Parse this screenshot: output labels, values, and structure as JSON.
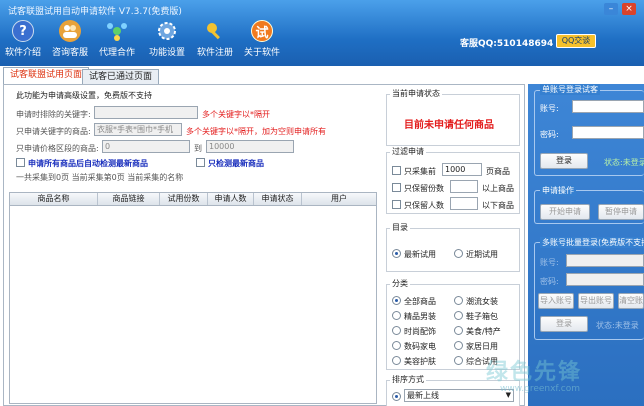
{
  "window": {
    "title": "试客联盟试用自动申请软件 V7.3.7(免费版)",
    "colors": {
      "titlebar": "#2a78cf",
      "accent_red": "#e31d1d",
      "link_blue": "#1a2fbd"
    }
  },
  "toolbar": {
    "items": [
      {
        "label": "软件介绍",
        "icon": "help-icon"
      },
      {
        "label": "咨询客服",
        "icon": "people-icon"
      },
      {
        "label": "代理合作",
        "icon": "network-icon"
      },
      {
        "label": "功能设置",
        "icon": "gear-icon"
      },
      {
        "label": "软件注册",
        "icon": "key-icon"
      },
      {
        "label": "关于软件",
        "icon": "try-icon",
        "glyph": "试"
      }
    ],
    "qq_label": "客服QQ:510148694",
    "qq_button": "QQ交谈"
  },
  "tabs": [
    {
      "label": "试客联盟试用页面",
      "active": true
    },
    {
      "label": "试客已通过页面",
      "active": false
    }
  ],
  "settings": {
    "heading": "此功能为申请高级设置，免费版不支持",
    "exclude_keyword_label": "申请时排除的关键字:",
    "exclude_keyword_value": "",
    "exclude_keyword_hint": "多个关键字以*隔开",
    "include_keyword_label": "只申请关键字的商品:",
    "include_keyword_value": "衣服*手表*围巾*手机",
    "include_keyword_hint": "多个关键字以*隔开，加为空则申请所有",
    "price_label": "只申请价格区段的商品:",
    "price_from": "0",
    "price_to_label": "到",
    "price_to": "10000",
    "auto_detect_label": "申请所有商品后自动检测最新商品",
    "only_new_label": "只检测最新商品",
    "summary_text": "一共采集到0页 当前采集第0页 当前采集的名称"
  },
  "table": {
    "columns": [
      "商品名称",
      "商品链接",
      "试用份数",
      "申请人数",
      "申请状态",
      "用户"
    ],
    "rows": []
  },
  "status": {
    "title": "当前申请状态",
    "message": "目前未申请任何商品"
  },
  "filter": {
    "title": "过滤申请",
    "items": [
      {
        "label": "只采集前",
        "value": "1000",
        "suffix": "页商品"
      },
      {
        "label": "只保留份数",
        "value": "",
        "suffix": "以上商品"
      },
      {
        "label": "只保留人数",
        "value": "",
        "suffix": "以下商品"
      }
    ]
  },
  "catalog": {
    "title": "目录",
    "options": [
      {
        "label": "最新试用",
        "selected": true
      },
      {
        "label": "近期试用",
        "selected": false
      }
    ]
  },
  "category": {
    "title": "分类",
    "options": [
      {
        "label": "全部商品",
        "selected": true
      },
      {
        "label": "潮流女装",
        "selected": false
      },
      {
        "label": "精品男装",
        "selected": false
      },
      {
        "label": "鞋子箱包",
        "selected": false
      },
      {
        "label": "时尚配饰",
        "selected": false
      },
      {
        "label": "美食/特产",
        "selected": false
      },
      {
        "label": "数码家电",
        "selected": false
      },
      {
        "label": "家居日用",
        "selected": false
      },
      {
        "label": "美容护肤",
        "selected": false
      },
      {
        "label": "综合试用",
        "selected": false
      }
    ]
  },
  "sort": {
    "title": "排序方式",
    "selected": "最新上线"
  },
  "single_login": {
    "title": "单账号登录试客",
    "account_label": "账号:",
    "password_label": "密码:",
    "login_button": "登录",
    "status_text": "状态:未登录"
  },
  "apply_ops": {
    "title": "申请操作",
    "start_button": "开始申请",
    "pause_button": "暂停申请"
  },
  "batch_login": {
    "title": "多账号批量登录(免费版不支持)",
    "account_label": "账号:",
    "password_label": "密码:",
    "import_button": "导入账号",
    "export_button": "导出账号",
    "clear_button": "清空账号",
    "login_button": "登录",
    "status_text": "状态:未登录"
  },
  "watermark": {
    "text": "绿色先锋",
    "sub": "www.greenxf.com"
  }
}
